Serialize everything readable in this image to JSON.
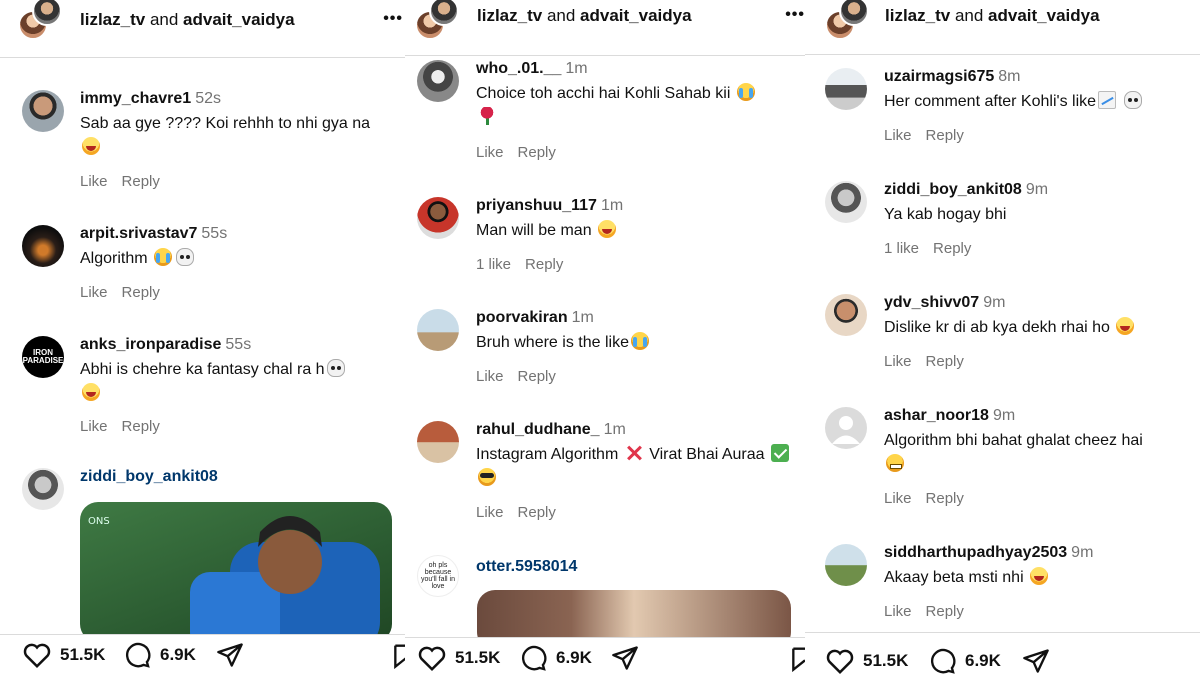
{
  "panels": [
    {
      "header": {
        "user1": "lizlaz_tv",
        "joiner": "and",
        "user2": "advait_vaidya",
        "more": "•••"
      },
      "comments": [
        {
          "user": "immy_chavre1",
          "time": "52s",
          "text": "Sab aa gye ???? Koi rehhh to nhi gya na",
          "emojis": [
            "laugh"
          ],
          "likes_text": "Like",
          "reply": "Reply"
        },
        {
          "user": "arpit.srivastav7",
          "time": "55s",
          "text": "Algorithm",
          "emojis": [
            "cry",
            "skull"
          ],
          "likes_text": "Like",
          "reply": "Reply"
        },
        {
          "user": "anks_ironparadise",
          "time": "55s",
          "text": "Abhi is chehre ka fantasy chal ra h",
          "emojis": [
            "skull",
            "laugh"
          ],
          "likes_text": "Like",
          "reply": "Reply",
          "avatar_label": "IRON PARADISE"
        },
        {
          "user": "ziddi_boy_ankit08",
          "time": "",
          "text": "",
          "emojis": [],
          "gif": true
        }
      ],
      "actions": {
        "likes": "51.5K",
        "comments": "6.9K"
      }
    },
    {
      "header": {
        "user1": "lizlaz_tv",
        "joiner": "and",
        "user2": "advait_vaidya",
        "more": "•••"
      },
      "comments": [
        {
          "user": "who_.01.__",
          "time": "1m",
          "text": "Choice toh acchi hai Kohli Sahab kii",
          "emojis": [
            "cry",
            "rose"
          ],
          "likes_text": "Like",
          "reply": "Reply"
        },
        {
          "user": "priyanshuu_117",
          "time": "1m",
          "text": "Man will be man",
          "emojis": [
            "laugh"
          ],
          "likes_text": "1 like",
          "reply": "Reply"
        },
        {
          "user": "poorvakiran",
          "time": "1m",
          "text": "Bruh where is the like",
          "emojis": [
            "cry"
          ],
          "likes_text": "Like",
          "reply": "Reply"
        },
        {
          "user": "rahul_dudhane_",
          "time": "1m",
          "text": "Instagram Algorithm",
          "text2": "Virat Bhai Auraa",
          "emojis": [
            "cross",
            "check",
            "cool"
          ],
          "likes_text": "Like",
          "reply": "Reply"
        },
        {
          "user": "otter.5958014",
          "time": "",
          "text": "",
          "emojis": [],
          "gif": true,
          "avatar_label": "oh pls because you'll fall in love"
        }
      ],
      "actions": {
        "likes": "51.5K",
        "comments": "6.9K"
      }
    },
    {
      "header": {
        "user1": "lizlaz_tv",
        "joiner": "and",
        "user2": "advait_vaidya",
        "more": ""
      },
      "comments": [
        {
          "user": "uzairmagsi675",
          "time": "8m",
          "text": "Her comment after Kohli's like",
          "emojis": [
            "chart",
            "skull"
          ],
          "likes_text": "Like",
          "reply": "Reply"
        },
        {
          "user": "ziddi_boy_ankit08",
          "time": "9m",
          "text": "Ya kab hogay bhi",
          "emojis": [],
          "likes_text": "1 like",
          "reply": "Reply"
        },
        {
          "user": "ydv_shivv07",
          "time": "9m",
          "text": "Dislike kr di ab kya dekh rhai ho",
          "emojis": [
            "laugh"
          ],
          "likes_text": "Like",
          "reply": "Reply"
        },
        {
          "user": "ashar_noor18",
          "time": "9m",
          "text": "Algorithm bhi bahat ghalat cheez hai",
          "emojis": [
            "grimace"
          ],
          "likes_text": "Like",
          "reply": "Reply"
        },
        {
          "user": "siddharthupadhyay2503",
          "time": "9m",
          "text": "Akaay beta msti nhi",
          "emojis": [
            "laugh"
          ],
          "likes_text": "Like",
          "reply": "Reply"
        }
      ],
      "actions": {
        "likes": "51.5K",
        "comments": "6.9K"
      }
    }
  ],
  "colors": {
    "link": "#00376b",
    "muted": "#737373",
    "border": "#dbdbdb"
  },
  "icons": [
    "heart-icon",
    "comment-icon",
    "share-icon",
    "bookmark-icon"
  ]
}
